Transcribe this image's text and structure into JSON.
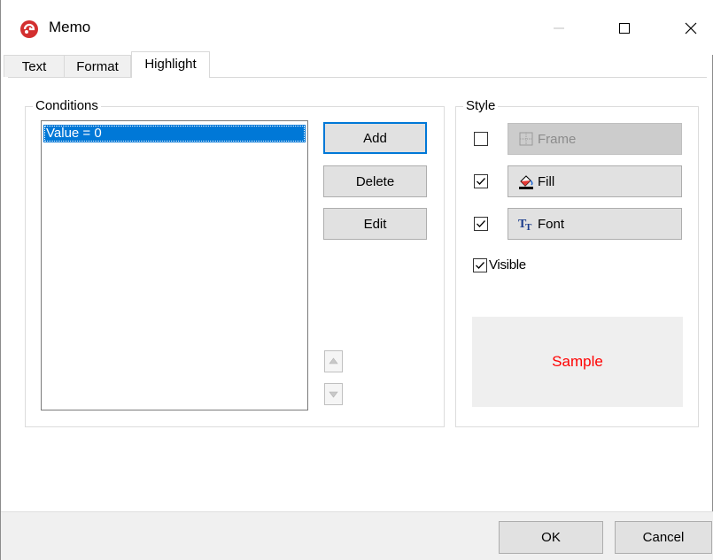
{
  "window": {
    "title": "Memo",
    "icon": "app-logo-icon"
  },
  "title_controls": {
    "minimize_icon": "minimize-icon",
    "maximize_icon": "maximize-icon",
    "close_icon": "close-icon"
  },
  "tabs": [
    {
      "label": "Text",
      "active": false
    },
    {
      "label": "Format",
      "active": false
    },
    {
      "label": "Highlight",
      "active": true
    }
  ],
  "conditions": {
    "label": "Conditions",
    "items": [
      "Value = 0"
    ],
    "selected_index": 0,
    "buttons": {
      "add": "Add",
      "delete": "Delete",
      "edit": "Edit"
    },
    "move_up_icon": "arrow-up-icon",
    "move_down_icon": "arrow-down-icon"
  },
  "style": {
    "label": "Style",
    "options": [
      {
        "label": "Frame",
        "checked": false,
        "enabled": false,
        "icon": "frame-icon"
      },
      {
        "label": "Fill",
        "checked": true,
        "enabled": true,
        "icon": "fill-bucket-icon"
      },
      {
        "label": "Font",
        "checked": true,
        "enabled": true,
        "icon": "font-icon"
      }
    ],
    "visible": {
      "label": "Visible",
      "checked": true
    },
    "sample_text": "Sample",
    "sample_color": "#ff0000"
  },
  "footer": {
    "ok": "OK",
    "cancel": "Cancel"
  },
  "colors": {
    "accent": "#0078d7",
    "button_bg": "#e1e1e1",
    "footer_bg": "#f0f0f0"
  }
}
